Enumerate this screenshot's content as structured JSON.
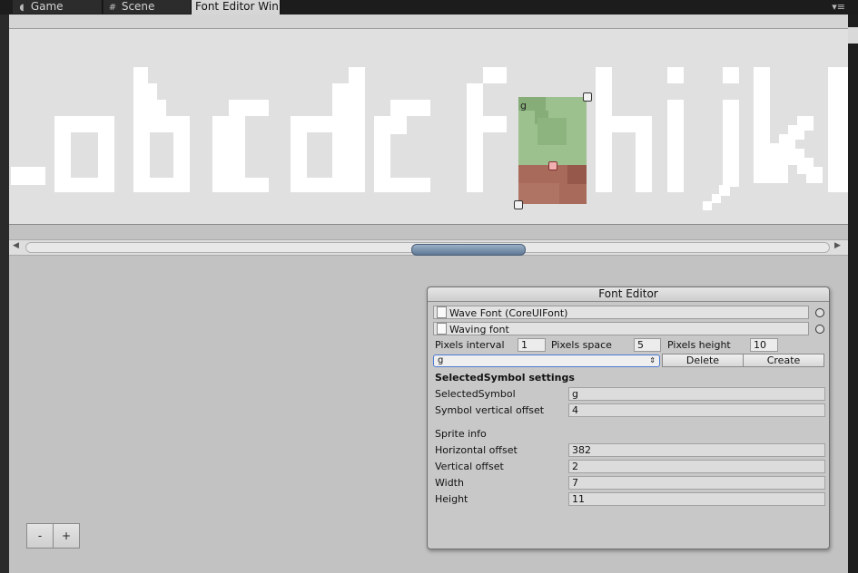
{
  "tabs": [
    {
      "label": "Game",
      "icon": "pacman-icon",
      "active": false
    },
    {
      "label": "Scene",
      "icon": "grid-icon",
      "active": false
    },
    {
      "label": "Font Editor Win",
      "icon": "",
      "active": true
    }
  ],
  "tab_menu_glyph": "▾≡",
  "atlas": {
    "glyphs": [
      "_",
      "a",
      "b",
      "c",
      "d",
      "e",
      "f",
      "g",
      "h",
      "i",
      "j",
      "k",
      "l"
    ],
    "selected_glyph": "g",
    "selection_color_top": "#9cc08e",
    "selection_color_bottom": "#a86a5a"
  },
  "scrollbar": {
    "left_arrow": "◀",
    "right_arrow": "▶",
    "thumb_start": 0.48,
    "thumb_fraction": 0.14
  },
  "zoom": {
    "minus": "-",
    "plus": "+"
  },
  "panel": {
    "title": "Font Editor",
    "font_asset": "Wave Font (CoreUIFont)",
    "font_name": "Waving font",
    "pixels_interval_label": "Pixels interval",
    "pixels_interval": "1",
    "pixels_space_label": "Pixels space",
    "pixels_space": "5",
    "pixels_height_label": "Pixels height",
    "pixels_height": "10",
    "symbol_select": "g",
    "delete_label": "Delete",
    "create_label": "Create",
    "section_title": "SelectedSymbol settings",
    "selected_symbol_label": "SelectedSymbol",
    "selected_symbol": "g",
    "vertical_offset_label": "Symbol vertical offset",
    "vertical_offset": "4",
    "sprite_info_label": "Sprite info",
    "horizontal_offset_label": "Horizontal offset",
    "horizontal_offset": "382",
    "sprite_vertical_offset_label": "Vertical offset",
    "sprite_vertical_offset": "2",
    "width_label": "Width",
    "width": "7",
    "height_label": "Height",
    "height": "11"
  }
}
